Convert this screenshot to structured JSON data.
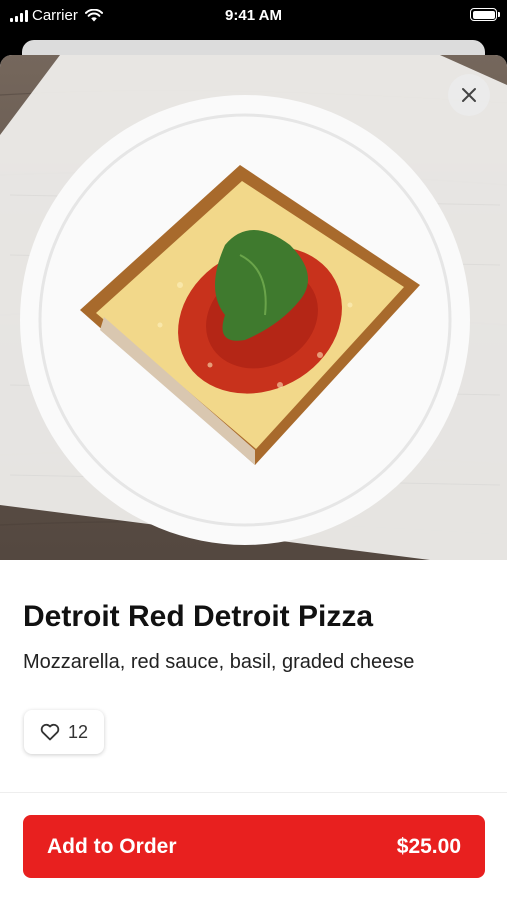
{
  "status_bar": {
    "carrier": "Carrier",
    "time": "9:41 AM",
    "icons": [
      "signal-icon",
      "wifi-icon",
      "battery-icon"
    ]
  },
  "item": {
    "title": "Detroit Red Detroit Pizza",
    "description": "Mozzarella, red sauce, basil, graded cheese",
    "likes": "12",
    "image": "pizza-slice-photo"
  },
  "actions": {
    "close_icon": "close-icon",
    "like_icon": "heart-icon"
  },
  "order": {
    "label": "Add to Order",
    "price": "$25.00"
  },
  "colors": {
    "accent": "#e8201f",
    "close_bg": "#ebebeb"
  }
}
